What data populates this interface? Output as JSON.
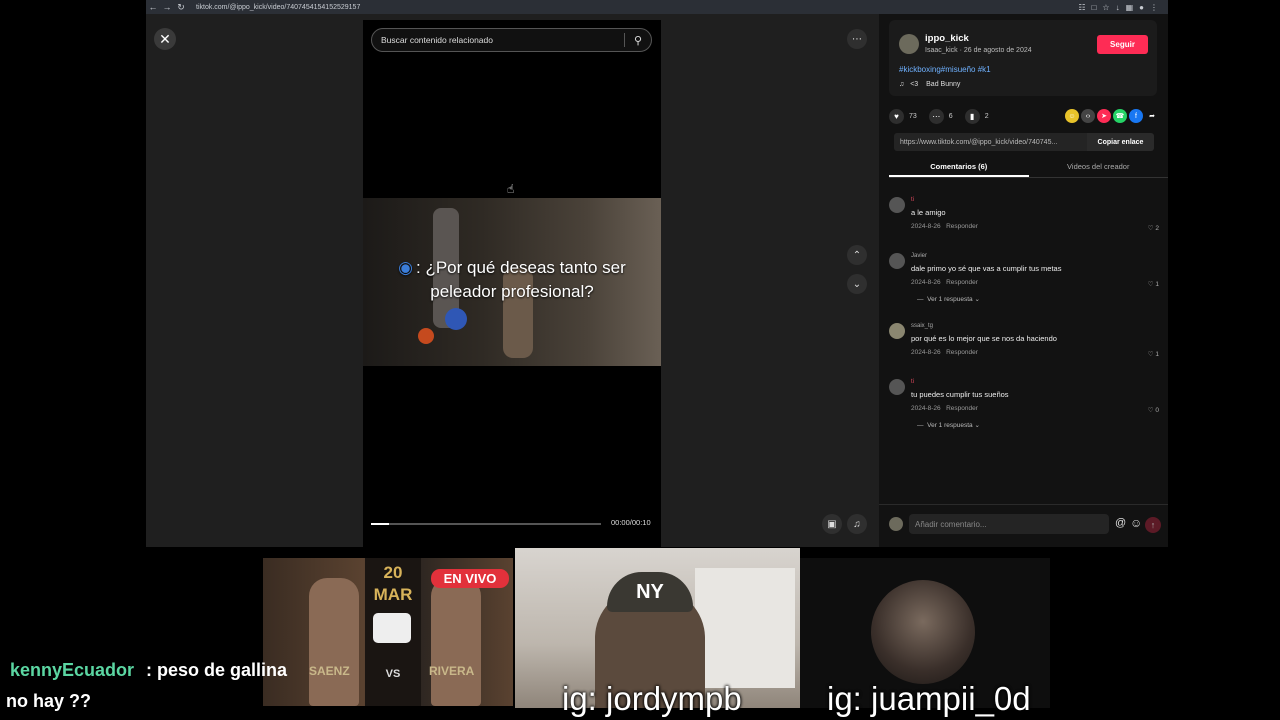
{
  "browser": {
    "url": "tiktok.com/@ippo_kick/video/7407454154152529157"
  },
  "video": {
    "search_placeholder": "Buscar contenido relacionado",
    "caption_line1": ": ¿Por qué deseas tanto ser",
    "caption_line2": "peleador profesional?",
    "time": "00:00/00:10",
    "progress": 0.08
  },
  "creator": {
    "name": "ippo_kick",
    "sub": "Isaac_kick · 26 de agosto de 2024",
    "follow": "Seguir",
    "hashtags": "#kickboxing#misueño #k1",
    "music_prefix": "<3",
    "music_artist": "Bad Bunny"
  },
  "stats": {
    "likes": "73",
    "comments": "6",
    "saves": "2"
  },
  "link": {
    "url": "https://www.tiktok.com/@ippo_kick/video/740745...",
    "copy": "Copiar enlace"
  },
  "tabs": [
    {
      "label": "Comentarios (6)"
    },
    {
      "label": "Videos del creador"
    }
  ],
  "comments": [
    {
      "user": "ti",
      "text": "a le amigo",
      "date": "2024-8-26",
      "reply": "Responder",
      "likes": "2",
      "replies": ""
    },
    {
      "user": "Javier",
      "text": "dale primo yo sé que vas a cumplir tus metas",
      "date": "2024-8-26",
      "reply": "Responder",
      "likes": "1",
      "replies": "Ver 1 respuesta"
    },
    {
      "user": "ssaix_tg",
      "text": "por qué es lo mejor que se nos da haciendo",
      "date": "2024-8-26",
      "reply": "Responder",
      "likes": "1",
      "replies": ""
    },
    {
      "user": "ti",
      "text": "tu puedes cumplir tus sueños",
      "date": "2024-8-26",
      "reply": "Responder",
      "likes": "0",
      "replies": "Ver 1 respuesta"
    }
  ],
  "comment_bar": {
    "placeholder": "Añadir comentario..."
  },
  "stream": {
    "poster_date": "20",
    "poster_month": "MAR",
    "poster_vs": "VS",
    "fighter_left": "SAENZ",
    "fighter_right": "RIVERA",
    "live_badge": "EN VIVO",
    "cap_logo": "NY",
    "cam1_label": "ig: jordympb",
    "cam2_label": "ig: juampii_0d"
  },
  "chat": {
    "user": "kennyEcuador",
    "colon": ":",
    "message_line1": "peso de gallina",
    "message_line2": "no hay ??"
  }
}
